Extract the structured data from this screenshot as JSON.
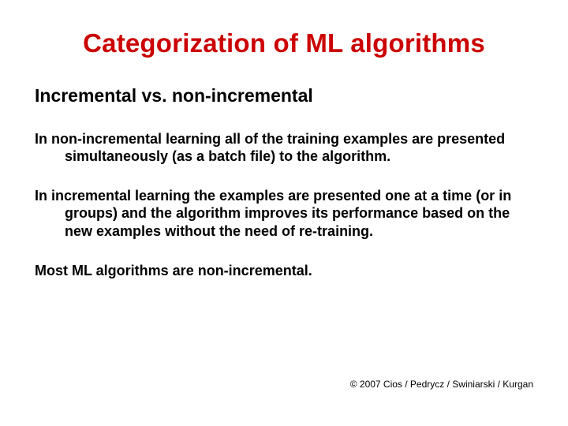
{
  "title": "Categorization of ML algorithms",
  "subheading": "Incremental vs. non-incremental",
  "paragraphs": {
    "p1": "In non-incremental learning all of the training examples are presented simultaneously (as a batch file) to the algorithm.",
    "p2": "In incremental learning the examples are presented one at a time (or in groups) and the algorithm improves its performance based on the new examples without the need of re-training.",
    "p3": "Most ML algorithms are non-incremental."
  },
  "footer": "© 2007 Cios / Pedrycz / Swiniarski / Kurgan"
}
